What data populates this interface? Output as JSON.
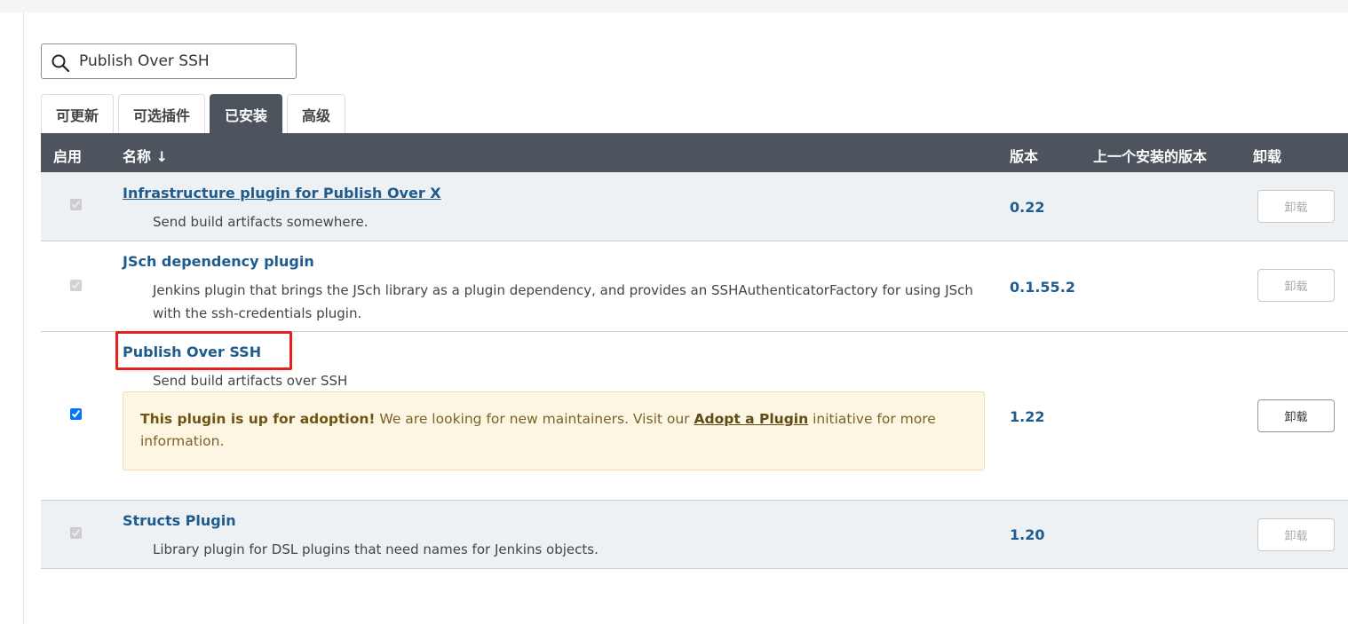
{
  "search": {
    "value": "Publish Over SSH",
    "icon": "search-icon"
  },
  "tabs": [
    {
      "label": "可更新",
      "active": false
    },
    {
      "label": "可选插件",
      "active": false
    },
    {
      "label": "已安装",
      "active": true
    },
    {
      "label": "高级",
      "active": false
    }
  ],
  "table": {
    "headers": {
      "enabled": "启用",
      "name": "名称 ↓",
      "version": "版本",
      "previous_version": "上一个安装的版本",
      "uninstall": "卸载"
    },
    "rows": [
      {
        "name": "Infrastructure plugin for Publish Over X",
        "description": "Send build artifacts somewhere.",
        "version": "0.22",
        "uninstall_label": "卸载",
        "enabled": true
      },
      {
        "name": "JSch dependency plugin",
        "description": "Jenkins plugin that brings the JSch library as a plugin dependency, and provides an SSHAuthenticatorFactory for using JSch with the ssh-credentials plugin.",
        "version": "0.1.55.2",
        "uninstall_label": "卸载",
        "enabled": true
      },
      {
        "name": "Publish Over SSH",
        "description": "Send build artifacts over SSH",
        "version": "1.22",
        "uninstall_label": "卸载",
        "enabled": true,
        "adoption": {
          "lead": "This plugin is up for adoption!",
          "text_before": " We are looking for new maintainers. Visit our ",
          "link": "Adopt a Plugin",
          "text_after": " initiative for more information."
        }
      },
      {
        "name": "Structs Plugin",
        "description": "Library plugin for DSL plugins that need names for Jenkins objects.",
        "version": "1.20",
        "uninstall_label": "卸载",
        "enabled": true
      }
    ]
  },
  "colors": {
    "header_bg": "#4d545d",
    "link": "#1e5b8e",
    "highlight": "#e8201c",
    "adopt_bg": "#fdf6e3"
  }
}
